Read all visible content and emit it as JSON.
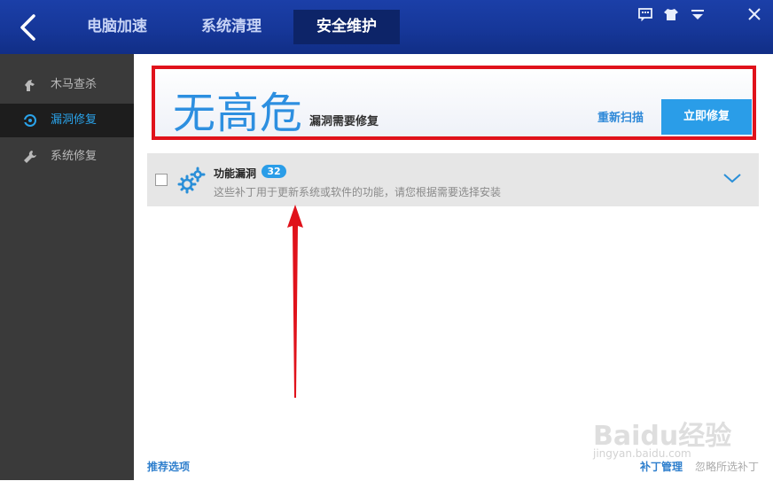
{
  "tabs": [
    {
      "label": "电脑加速",
      "active": false
    },
    {
      "label": "系统清理",
      "active": false
    },
    {
      "label": "安全维护",
      "active": true
    }
  ],
  "window_buttons": [
    "feedback-icon",
    "skin-icon",
    "menu-icon",
    "close-icon"
  ],
  "sidebar": {
    "items": [
      {
        "label": "木马查杀",
        "icon": "horse-icon",
        "active": false
      },
      {
        "label": "漏洞修复",
        "icon": "shield-scan-icon",
        "active": true
      },
      {
        "label": "系统修复",
        "icon": "wrench-icon",
        "active": false
      }
    ]
  },
  "status": {
    "headline": "无高危",
    "subtitle": "漏洞需要修复",
    "rescan_label": "重新扫描",
    "fix_now_label": "立即修复"
  },
  "vulnerability_group": {
    "title": "功能漏洞",
    "count": "32",
    "description": "这些补丁用于更新系统或软件的功能，请您根据需要选择安装",
    "checked": false
  },
  "footer": {
    "recommend_label": "推荐选项",
    "patch_manage_label": "补丁管理",
    "ignore_selected_label": "忽略所选补丁"
  },
  "watermark": {
    "brand": "Baidu经验",
    "url": "jingyan.baidu.com"
  },
  "colors": {
    "accent": "#2a9de8",
    "titlebar": "#163799",
    "sidebar": "#3a3a3a",
    "highlight_box": "#e0121b"
  }
}
